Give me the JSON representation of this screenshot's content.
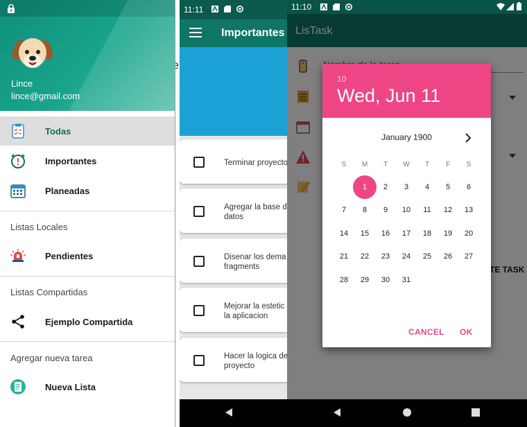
{
  "drawer": {
    "user_name": "Lince",
    "user_email": "lince@gmail.com",
    "items": [
      {
        "label": "Todas"
      },
      {
        "label": "Importantes"
      },
      {
        "label": "Planeadas"
      }
    ],
    "sections": [
      {
        "title": "Listas Locales",
        "items": [
          {
            "label": "Pendientes"
          }
        ]
      },
      {
        "title": "Listas Compartidas",
        "items": [
          {
            "label": "Ejemplo Compartida"
          }
        ]
      },
      {
        "title": "Agregar nueva tarea",
        "items": [
          {
            "label": "Nueva Lista"
          }
        ]
      }
    ],
    "colors": {
      "header": "#19a58d",
      "active_text": "#17695c"
    }
  },
  "list_screen": {
    "status_time": "11:11",
    "title": "Importantes",
    "side_letter": "e",
    "tasks": [
      {
        "line1": "Terminar proyecto",
        "line2": ""
      },
      {
        "line1": "Agregar la base d",
        "line2": "datos"
      },
      {
        "line1": "Disenar los dema",
        "line2": "fragments"
      },
      {
        "line1": "Mejorar la estetic",
        "line2": "la aplicacion"
      },
      {
        "line1": "Hacer la logica de",
        "line2": "proyecto"
      }
    ]
  },
  "form_screen": {
    "status_time": "11:10",
    "app_title": "LisTask",
    "fields": [
      {
        "hint": "Nombre de la tarea"
      }
    ],
    "create_button": "TE TASK"
  },
  "datepicker": {
    "year": "10",
    "date_heading": "Wed, Jun 11",
    "month_label": "January 1900",
    "weekdays": [
      "S",
      "M",
      "T",
      "W",
      "T",
      "F",
      "S"
    ],
    "selected_day": 1,
    "cancel_label": "CANCEL",
    "ok_label": "OK",
    "accent_color": "#ee4585"
  }
}
